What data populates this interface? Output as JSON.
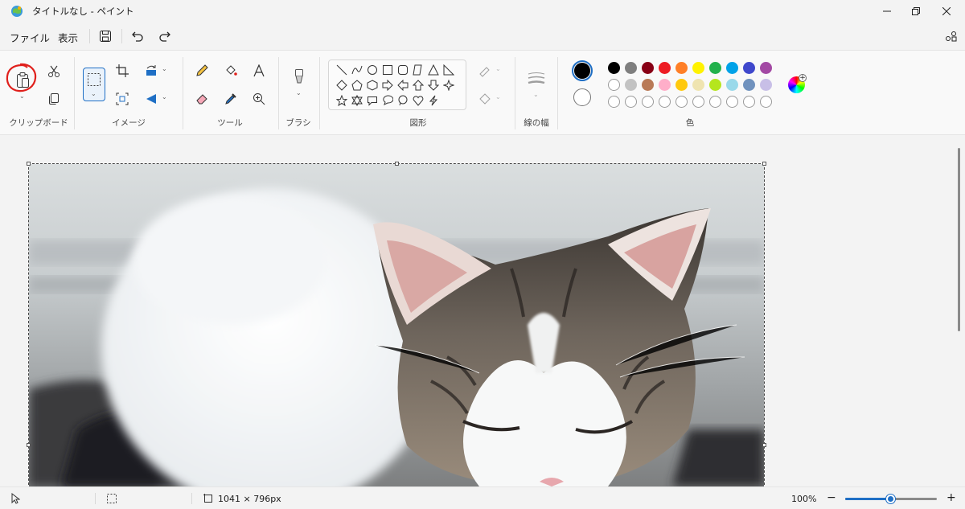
{
  "window": {
    "title": "タイトルなし - ペイント",
    "buttons": [
      "minimize",
      "restore",
      "close"
    ]
  },
  "menu": {
    "file_label": "ファイル",
    "view_label": "表示"
  },
  "ribbon": {
    "groups": {
      "clipboard": "クリップボード",
      "image": "イメージ",
      "tools": "ツール",
      "brush": "ブラシ",
      "shapes": "図形",
      "line_width": "線の幅",
      "colors": "色"
    },
    "current_colors": {
      "primary": "#000000",
      "secondary": "#ffffff"
    },
    "palette_row1": [
      "#000000",
      "#7f7f7f",
      "#880015",
      "#ed1c24",
      "#ff7f27",
      "#fff200",
      "#22b14c",
      "#00a2e8",
      "#3f48cc",
      "#a349a4"
    ],
    "palette_row2": [
      "#ffffff",
      "#c3c3c3",
      "#b97a57",
      "#ffaec9",
      "#ffc90e",
      "#efe4b0",
      "#b5e61d",
      "#99d9ea",
      "#7092be",
      "#c8bfe7"
    ]
  },
  "annotation": {
    "color": "#e0201c",
    "target": "paste-button"
  },
  "status": {
    "image_size": "1041 × 796px",
    "zoom": "100%",
    "zoom_fraction": 0.5
  }
}
